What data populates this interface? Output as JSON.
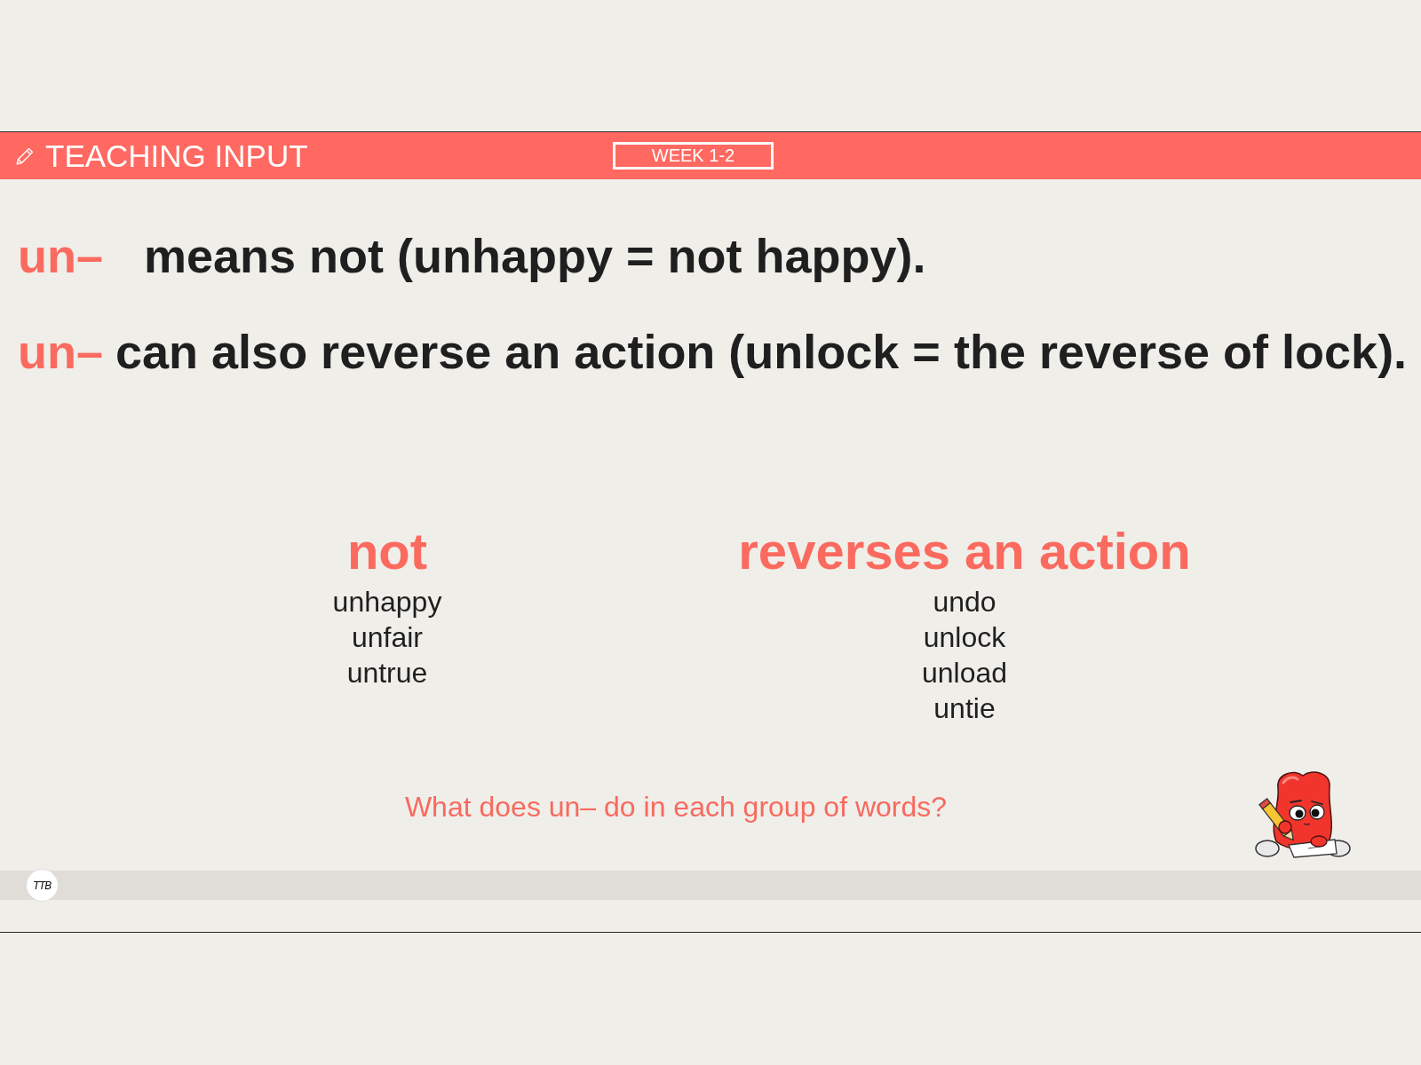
{
  "header": {
    "title": "TEACHING INPUT",
    "badge": "WEEK 1-2"
  },
  "statements": [
    {
      "prefix": "un–",
      "text": "means not (unhappy = not happy)."
    },
    {
      "prefix": "un–",
      "text": "can also reverse an action (unlock = the reverse of lock)."
    }
  ],
  "groups": [
    {
      "heading": "not",
      "words": [
        "unhappy",
        "unfair",
        "untrue"
      ]
    },
    {
      "heading": "reverses an action",
      "words": [
        "undo",
        "unlock",
        "unload",
        "untie"
      ]
    }
  ],
  "question": "What does un– do in each group of words?",
  "footer": {
    "logo": "TTB"
  }
}
